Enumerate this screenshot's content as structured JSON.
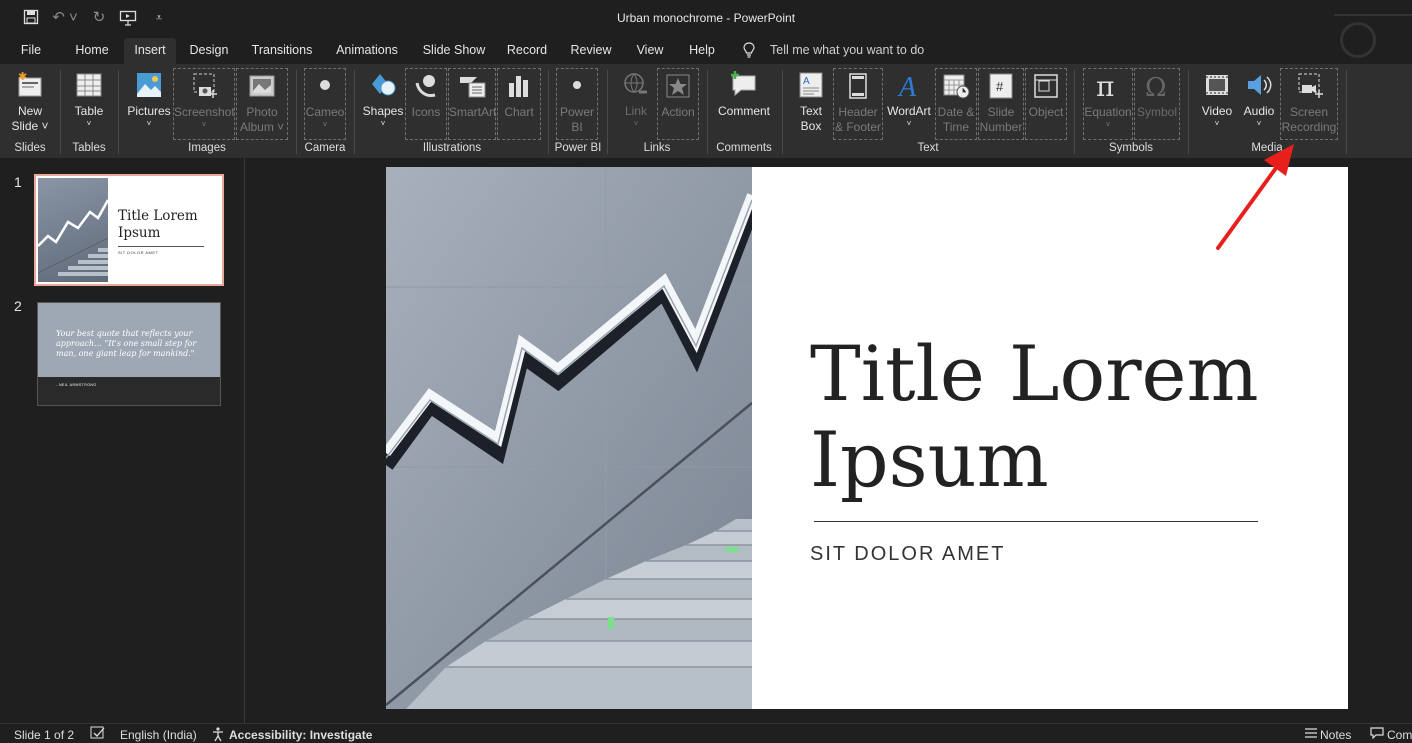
{
  "window": {
    "title": "Urban monochrome  -  PowerPoint"
  },
  "quick_access": [
    "save-icon",
    "undo-icon",
    "redo-icon",
    "start-from-beginning-icon",
    "customize-icon"
  ],
  "menu": {
    "file": "File",
    "tabs": [
      "Home",
      "Insert",
      "Design",
      "Transitions",
      "Animations",
      "Slide Show",
      "Record",
      "Review",
      "View",
      "Help"
    ],
    "active_tab": "Insert",
    "tell_me": "Tell me what you want to do"
  },
  "ribbon": {
    "groups": {
      "slides": "Slides",
      "tables": "Tables",
      "images": "Images",
      "camera": "Camera",
      "illustrations": "Illustrations",
      "powerbi": "Power BI",
      "links": "Links",
      "comments": "Comments",
      "text": "Text",
      "symbols": "Symbols",
      "media": "Media"
    },
    "buttons": {
      "new_slide": [
        "New",
        "Slide"
      ],
      "table": "Table",
      "pictures": "Pictures",
      "screenshot": "Screenshot",
      "photo_album": [
        "Photo",
        "Album"
      ],
      "cameo": "Cameo",
      "shapes": "Shapes",
      "icons": "Icons",
      "smartart": "SmartArt",
      "chart": "Chart",
      "power_bi": [
        "Power",
        "BI"
      ],
      "link": "Link",
      "action": "Action",
      "comment": "Comment",
      "text_box": [
        "Text",
        "Box"
      ],
      "header_footer": [
        "Header",
        "& Footer"
      ],
      "wordart": "WordArt",
      "date_time": [
        "Date &",
        "Time"
      ],
      "slide_number": [
        "Slide",
        "Number"
      ],
      "object": "Object",
      "equation": "Equation",
      "symbol": "Symbol",
      "video": "Video",
      "audio": "Audio",
      "screen_recording": [
        "Screen",
        "Recording"
      ]
    }
  },
  "thumbnails": [
    {
      "number": "1",
      "title": "Title Lorem Ipsum",
      "subtitle": "SIT DOLOR AMET"
    },
    {
      "number": "2",
      "quote": "Your best quote that reflects your approach… \"It's one small step for man, one giant leap for mankind.\"",
      "author": "- NEIL ARMSTRONG"
    }
  ],
  "slide": {
    "title_line1": "Title Lorem",
    "title_line2": "Ipsum",
    "subtitle": "SIT DOLOR AMET"
  },
  "status": {
    "slide_info": "Slide 1 of 2",
    "language": "English (India)",
    "accessibility": "Accessibility: Investigate",
    "notes": "Notes",
    "comments": "Comm"
  },
  "colors": {
    "accent_arrow": "#e8201c",
    "thumb_selected_border": "#e8a89a"
  }
}
